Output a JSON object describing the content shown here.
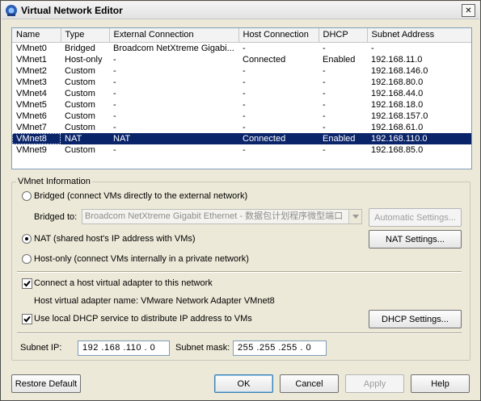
{
  "window": {
    "title": "Virtual Network Editor",
    "close_glyph": "✕"
  },
  "network_list": {
    "columns": [
      "Name",
      "Type",
      "External Connection",
      "Host Connection",
      "DHCP",
      "Subnet Address"
    ],
    "rows": [
      [
        "VMnet0",
        "Bridged",
        "Broadcom NetXtreme Gigabi...",
        "-",
        "-",
        "-"
      ],
      [
        "VMnet1",
        "Host-only",
        "-",
        "Connected",
        "Enabled",
        "192.168.11.0"
      ],
      [
        "VMnet2",
        "Custom",
        "-",
        "-",
        "-",
        "192.168.146.0"
      ],
      [
        "VMnet3",
        "Custom",
        "-",
        "-",
        "-",
        "192.168.80.0"
      ],
      [
        "VMnet4",
        "Custom",
        "-",
        "-",
        "-",
        "192.168.44.0"
      ],
      [
        "VMnet5",
        "Custom",
        "-",
        "-",
        "-",
        "192.168.18.0"
      ],
      [
        "VMnet6",
        "Custom",
        "-",
        "-",
        "-",
        "192.168.157.0"
      ],
      [
        "VMnet7",
        "Custom",
        "-",
        "-",
        "-",
        "192.168.61.0"
      ],
      [
        "VMnet8",
        "NAT",
        "NAT",
        "Connected",
        "Enabled",
        "192.168.110.0"
      ],
      [
        "VMnet9",
        "Custom",
        "-",
        "-",
        "-",
        "192.168.85.0"
      ]
    ],
    "selected_index": 8
  },
  "vmnet_info": {
    "group_label": "VMnet Information",
    "bridged_label": "Bridged (connect VMs directly to the external network)",
    "bridged_to_label": "Bridged to:",
    "bridged_to_value": "Broadcom NetXtreme Gigabit Ethernet - 数据包计划程序微型端口",
    "auto_settings_label": "Automatic Settings...",
    "nat_label": "NAT (shared host's IP address with VMs)",
    "nat_settings_label": "NAT Settings...",
    "hostonly_label": "Host-only (connect VMs internally in a private network)",
    "selected_mode": "nat",
    "connect_adapter_label": "Connect a host virtual adapter to this network",
    "connect_adapter_checked": true,
    "adapter_name_label": "Host virtual adapter name: VMware Network Adapter VMnet8",
    "dhcp_label": "Use local DHCP service to distribute IP address to VMs",
    "dhcp_checked": true,
    "dhcp_settings_label": "DHCP Settings...",
    "subnet_ip_label": "Subnet IP:",
    "subnet_ip_value": "192 .168 .110 . 0",
    "subnet_mask_label": "Subnet mask:",
    "subnet_mask_value": "255 .255 .255 . 0"
  },
  "footer": {
    "restore_label": "Restore Default",
    "ok_label": "OK",
    "cancel_label": "Cancel",
    "apply_label": "Apply",
    "help_label": "Help"
  },
  "colors": {
    "selection": "#0a246a",
    "dialog_bg": "#ece9d8"
  }
}
